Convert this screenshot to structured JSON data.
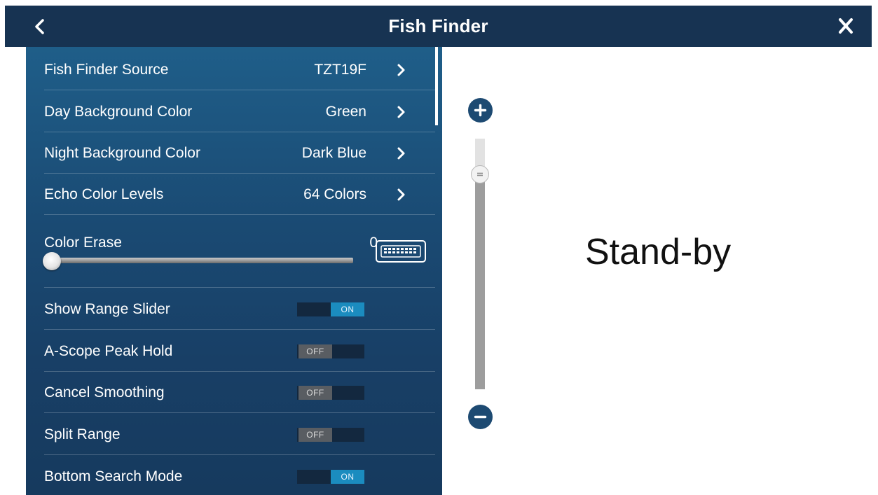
{
  "header": {
    "back_icon": "chevron-left-icon",
    "title": "Fish Finder",
    "close_icon": "close-icon",
    "bg_color": "#173352"
  },
  "menu": {
    "fish_finder_source": {
      "label": "Fish Finder Source",
      "value": "TZT19F"
    },
    "day_background_color": {
      "label": "Day Background Color",
      "value": "Green"
    },
    "night_background_color": {
      "label": "Night Background Color",
      "value": "Dark Blue"
    },
    "echo_color_levels": {
      "label": "Echo Color Levels",
      "value": "64 Colors"
    },
    "color_erase": {
      "label": "Color Erase",
      "value": "0",
      "icon": "keyboard-icon"
    },
    "show_range_slider": {
      "label": "Show Range Slider",
      "state": "ON"
    },
    "a_scope_peak_hold": {
      "label": "A-Scope Peak Hold",
      "state": "OFF"
    },
    "cancel_smoothing": {
      "label": "Cancel Smoothing",
      "state": "OFF"
    },
    "split_range": {
      "label": "Split Range",
      "state": "OFF"
    },
    "bottom_search_mode": {
      "label": "Bottom Search Mode",
      "state": "ON"
    }
  },
  "range_slider": {
    "plus_icon": "plus-icon",
    "minus_icon": "minus-icon",
    "level_fraction": 0.14
  },
  "display": {
    "status": "Stand-by"
  },
  "colors": {
    "accent_on": "#1b8cbf",
    "off": "#595d62",
    "panel": "#1a4a73"
  }
}
